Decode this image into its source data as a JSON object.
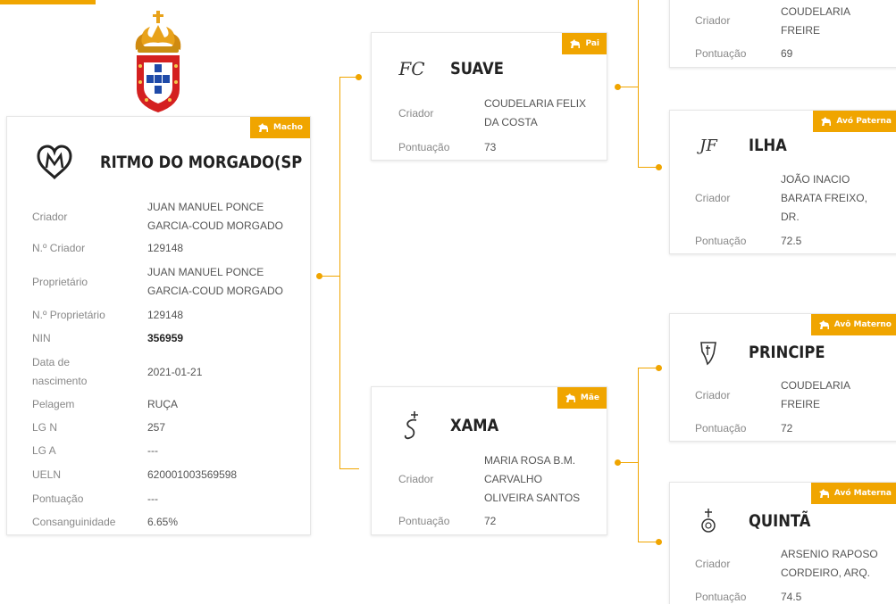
{
  "colors": {
    "accent": "#f0a500",
    "text": "#555555",
    "label": "#888888",
    "title": "#222222"
  },
  "horse": {
    "badge": "Macho",
    "brand_icon": "heart-m-brand-icon",
    "name": "RITMO DO MORGADO(SP",
    "fields": [
      {
        "label": "Criador",
        "value": "JUAN MANUEL PONCE GARCIA-COUD MORGADO"
      },
      {
        "label": "N.º Criador",
        "value": "129148"
      },
      {
        "label": "Proprietário",
        "value": "JUAN MANUEL PONCE GARCIA-COUD MORGADO"
      },
      {
        "label": "N.º Proprietário",
        "value": "129148"
      },
      {
        "label": "NIN",
        "value": "356959"
      },
      {
        "label": "Data de nascimento",
        "value": "2021-01-21"
      },
      {
        "label": "Pelagem",
        "value": "RUÇA"
      },
      {
        "label": "LG N",
        "value": "257"
      },
      {
        "label": "LG A",
        "value": "---"
      },
      {
        "label": "UELN",
        "value": "620001003569598"
      },
      {
        "label": "Pontuação",
        "value": "---"
      },
      {
        "label": "Consanguinidade",
        "value": "6.65%"
      }
    ]
  },
  "sire": {
    "badge": "Pai",
    "brand": "FC",
    "name": "SUAVE",
    "criador_label": "Criador",
    "criador": "COUDELARIA FELIX DA COSTA",
    "pontuacao_label": "Pontuação",
    "pontuacao": "73"
  },
  "dam": {
    "badge": "Mãe",
    "brand_icon": "ring-cross-brand-icon",
    "name": "XAMA",
    "criador_label": "Criador",
    "criador": "MARIA ROSA B.M. CARVALHO OLIVEIRA SANTOS",
    "pontuacao_label": "Pontuação",
    "pontuacao": "72"
  },
  "gp_top": {
    "criador_label": "Criador",
    "criador": "COUDELARIA FREIRE",
    "pontuacao_label": "Pontuação",
    "pontuacao": "69"
  },
  "gp_ilha": {
    "badge": "Avó Paterna",
    "brand": "JF",
    "name": "ILHA",
    "criador_label": "Criador",
    "criador": "JOÃO INACIO BARATA FREIXO, DR.",
    "pontuacao_label": "Pontuação",
    "pontuacao": "72.5"
  },
  "gp_principe": {
    "badge": "Avô Materno",
    "brand_icon": "shield-brand-icon",
    "name": "PRINCIPE",
    "criador_label": "Criador",
    "criador": "COUDELARIA FREIRE",
    "pontuacao_label": "Pontuação",
    "pontuacao": "72"
  },
  "gp_quinta": {
    "badge": "Avó Materna",
    "brand_icon": "cross-ring-brand-icon",
    "name": "QUINTÃ",
    "criador_label": "Criador",
    "criador": "ARSENIO RAPOSO CORDEIRO, ARQ.",
    "pontuacao_label": "Pontuação",
    "pontuacao": "74.5"
  }
}
